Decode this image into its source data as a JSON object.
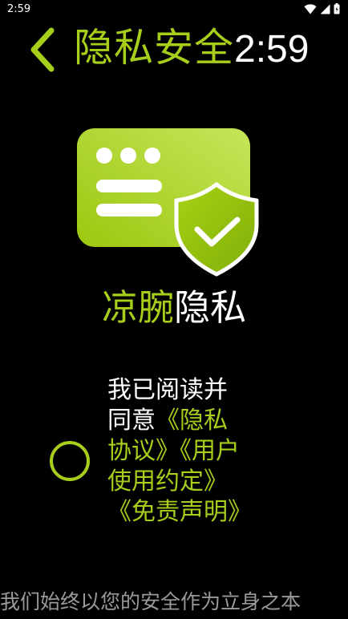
{
  "status_bar": {
    "time": "2:59"
  },
  "header": {
    "title": "隐私安全",
    "clock": "2:59"
  },
  "brand": {
    "part1": "凉腕",
    "part2": "隐私"
  },
  "agreement": {
    "prefix": "我已阅读并同意",
    "privacy_link": "《隐私协议》",
    "user_link": "《用户使用约定》",
    "disclaimer_link": "《免责声明》"
  },
  "footer": {
    "slogan": "我们始终以您的安全作为立身之本"
  },
  "colors": {
    "accent": "#a6ce1a",
    "background": "#000000",
    "text": "#ffffff",
    "muted": "#9a9a9a"
  },
  "icons": {
    "back": "chevron-left-icon",
    "wifi": "wifi-icon",
    "signal": "signal-icon",
    "battery": "battery-icon",
    "illustration": "privacy-shield-card-icon"
  }
}
